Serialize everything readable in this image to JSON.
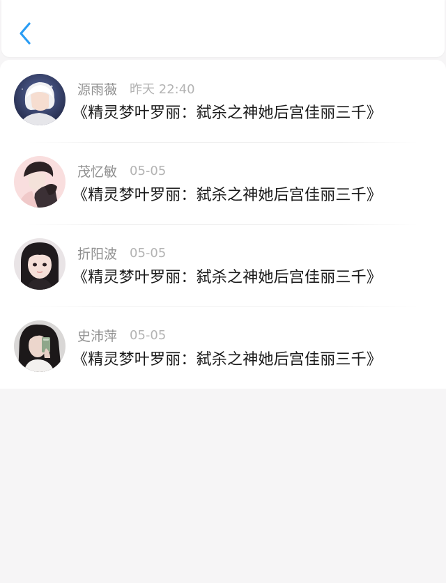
{
  "colors": {
    "accent": "#2a9df4",
    "background": "#f6f5f6",
    "name_text": "#8f8f8f",
    "time_text": "#b3b3b3",
    "content_text": "#1a1a1a"
  },
  "header": {
    "back_icon": "chevron-left-icon"
  },
  "messages": [
    {
      "avatar": "anime-boy-avatar",
      "name": "源雨薇",
      "time": "昨天 22:40",
      "content": "《精灵梦叶罗丽：弑杀之神她后宫佳丽三千》"
    },
    {
      "avatar": "anime-couple-avatar",
      "name": "茂忆敏",
      "time": "05-05",
      "content": "《精灵梦叶罗丽：弑杀之神她后宫佳丽三千》"
    },
    {
      "avatar": "girl-photo-avatar",
      "name": "折阳波",
      "time": "05-05",
      "content": "《精灵梦叶罗丽：弑杀之神她后宫佳丽三千》"
    },
    {
      "avatar": "girl-selfie-avatar",
      "name": "史沛萍",
      "time": "05-05",
      "content": "《精灵梦叶罗丽：弑杀之神她后宫佳丽三千》"
    }
  ]
}
